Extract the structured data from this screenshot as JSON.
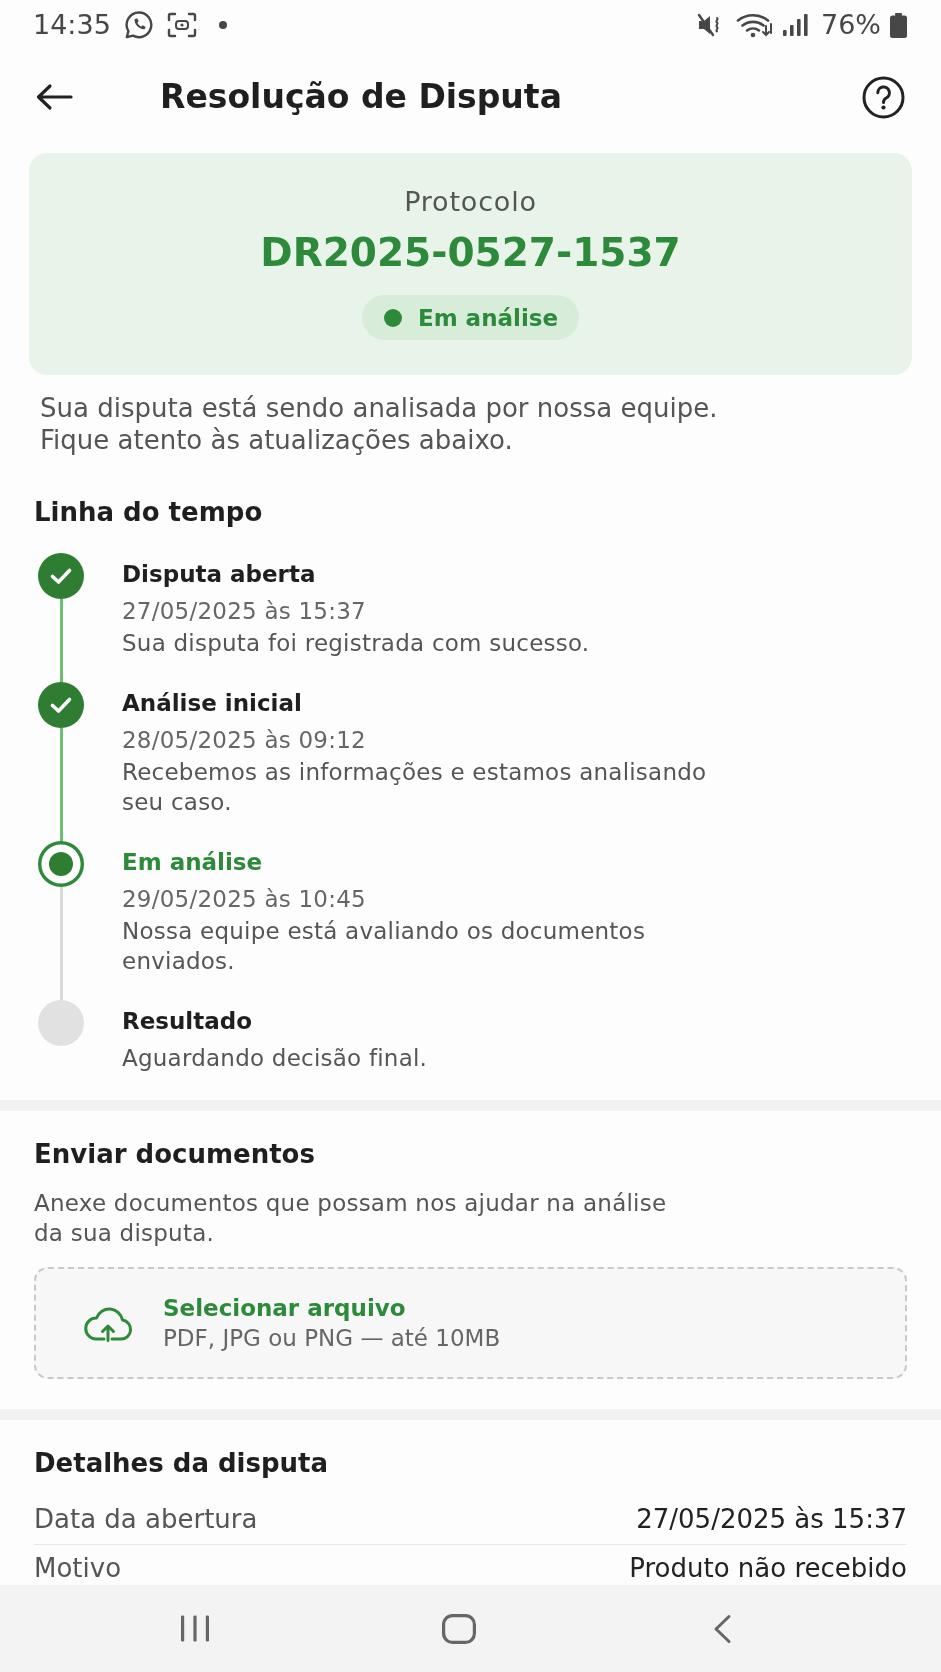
{
  "status_bar": {
    "time": "14:35",
    "battery": "76%"
  },
  "header": {
    "title": "Resolução de Disputa"
  },
  "protocol_card": {
    "label": "Protocolo",
    "number": "DR2025-0527-1537",
    "status": "Em análise"
  },
  "intro": [
    "Sua disputa está sendo analisada por nossa equipe.",
    "Fique atento às atualizações abaixo."
  ],
  "timeline": {
    "title": "Linha do tempo",
    "steps": [
      {
        "kind": "done",
        "title": "Disputa aberta",
        "date": "27/05/2025 às 15:37",
        "description": "Sua disputa foi registrada com sucesso."
      },
      {
        "kind": "done",
        "title": "Análise inicial",
        "date": "28/05/2025 às 09:12",
        "description": "Recebemos as informações e estamos analisando seu caso."
      },
      {
        "kind": "current",
        "title": "Em análise",
        "date": "29/05/2025 às 10:45",
        "description": "Nossa equipe está avaliando os documentos enviados."
      },
      {
        "kind": "pending",
        "title": "Resultado",
        "description": "Aguardando decisão final."
      }
    ]
  },
  "upload": {
    "title": "Enviar documentos",
    "description": "Anexe documentos que possam nos ajudar na análise da sua disputa.",
    "button": {
      "label": "Selecionar arquivo",
      "hint": "PDF, JPG ou PNG — até 10MB"
    }
  },
  "details": {
    "title": "Detalhes da disputa",
    "rows": [
      {
        "label": "Data da abertura",
        "value": "27/05/2025 às 15:37"
      },
      {
        "label": "Motivo",
        "value": "Produto não recebido"
      }
    ]
  }
}
